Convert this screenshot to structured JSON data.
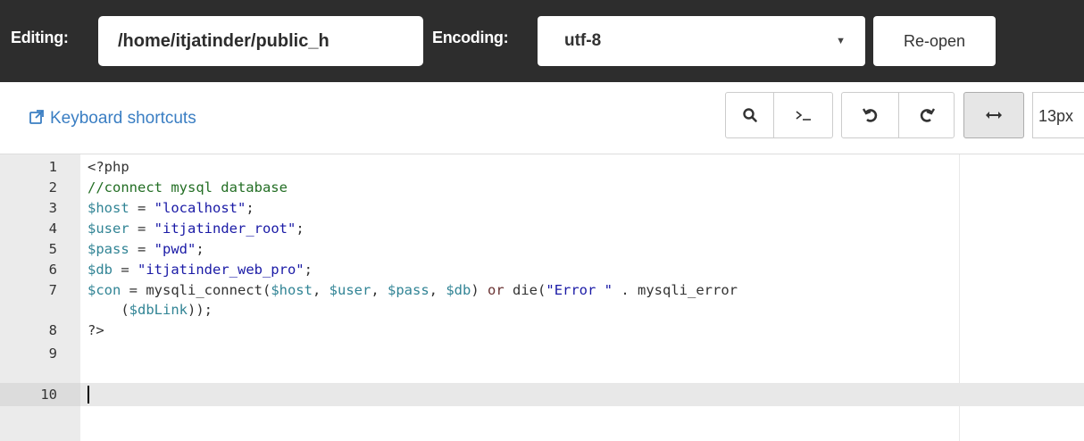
{
  "header": {
    "editing_label": "Editing:",
    "path_value": "/home/itjatinder/public_h",
    "encoding_label": "Encoding:",
    "encoding_value": "utf-8",
    "reopen_label": "Re-open"
  },
  "toolbar": {
    "keyboard_shortcuts_label": "Keyboard shortcuts",
    "font_size_value": "13px"
  },
  "editor": {
    "lines": [
      {
        "n": "1",
        "tokens": [
          [
            "meta",
            "<?php"
          ]
        ]
      },
      {
        "n": "2",
        "tokens": [
          [
            "comment",
            "//connect mysql database"
          ]
        ]
      },
      {
        "n": "3",
        "tokens": [
          [
            "var",
            "$host"
          ],
          [
            "plain",
            " = "
          ],
          [
            "str",
            "\"localhost\""
          ],
          [
            "plain",
            ";"
          ]
        ]
      },
      {
        "n": "4",
        "tokens": [
          [
            "var",
            "$user"
          ],
          [
            "plain",
            " = "
          ],
          [
            "str",
            "\"itjatinder_root\""
          ],
          [
            "plain",
            ";"
          ]
        ]
      },
      {
        "n": "5",
        "tokens": [
          [
            "var",
            "$pass"
          ],
          [
            "plain",
            " = "
          ],
          [
            "str",
            "\"pwd\""
          ],
          [
            "plain",
            ";"
          ]
        ]
      },
      {
        "n": "6",
        "tokens": [
          [
            "var",
            "$db"
          ],
          [
            "plain",
            " = "
          ],
          [
            "str",
            "\"itjatinder_web_pro\""
          ],
          [
            "plain",
            ";"
          ]
        ]
      },
      {
        "n": "7",
        "tokens": [
          [
            "var",
            "$con"
          ],
          [
            "plain",
            " = mysqli_connect("
          ],
          [
            "var",
            "$host"
          ],
          [
            "plain",
            ", "
          ],
          [
            "var",
            "$user"
          ],
          [
            "plain",
            ", "
          ],
          [
            "var",
            "$pass"
          ],
          [
            "plain",
            ", "
          ],
          [
            "var",
            "$db"
          ],
          [
            "plain",
            ") "
          ],
          [
            "kw",
            "or"
          ],
          [
            "plain",
            " die("
          ],
          [
            "str",
            "\"Error \""
          ],
          [
            "plain",
            " . mysqli_error"
          ]
        ]
      },
      {
        "n": "",
        "tokens": [
          [
            "plain",
            "    ("
          ],
          [
            "var",
            "$dbLink"
          ],
          [
            "plain",
            "));"
          ]
        ]
      },
      {
        "n": "8",
        "tokens": [
          [
            "meta",
            "?>"
          ]
        ]
      },
      {
        "n": "9",
        "tokens": []
      },
      {
        "n": "10",
        "tokens": []
      }
    ]
  }
}
